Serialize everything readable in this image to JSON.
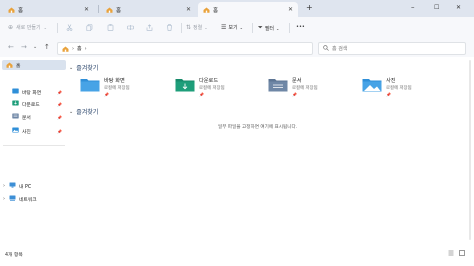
{
  "tabs": [
    {
      "label": "홈",
      "active": false
    },
    {
      "label": "홈",
      "active": false
    },
    {
      "label": "홈",
      "active": true
    }
  ],
  "new_tab_glyph": "+",
  "window_controls": {
    "minimize": "–",
    "maximize": "☐",
    "close": "✕"
  },
  "toolbar": {
    "new_label": "새로 만들기",
    "sort_label": "정렬",
    "view_label": "보기",
    "filter_label": "필터",
    "more_glyph": "•••"
  },
  "address": {
    "root": "홈",
    "chevron": "›"
  },
  "search": {
    "placeholder": "홈 검색"
  },
  "sidebar": {
    "home": "홈",
    "quick": [
      "바탕 화면",
      "다운로드",
      "문서",
      "사진"
    ],
    "this_pc": "내 PC",
    "network": "네트워크"
  },
  "main": {
    "favorites_title": "즐겨찾기",
    "favorites": [
      {
        "name": "바탕 화면",
        "sub": "로컬에 저장됨"
      },
      {
        "name": "다운로드",
        "sub": "로컬에 저장됨"
      },
      {
        "name": "문서",
        "sub": "로컬에 저장됨"
      },
      {
        "name": "사진",
        "sub": "로컬에 저장됨"
      }
    ],
    "favorites2_title": "즐겨찾기",
    "empty_text": "일부 파일을 고정하면 여기에 표시됩니다."
  },
  "status": {
    "count": "4개 항목"
  },
  "colors": {
    "tabbar": "#dfe5ef",
    "toolbar": "#f7f8fb",
    "accent": "#0067c0",
    "folder_blue": "#2f8fd8",
    "folder_green": "#1e9e7a",
    "folder_slate": "#6f87a6"
  }
}
